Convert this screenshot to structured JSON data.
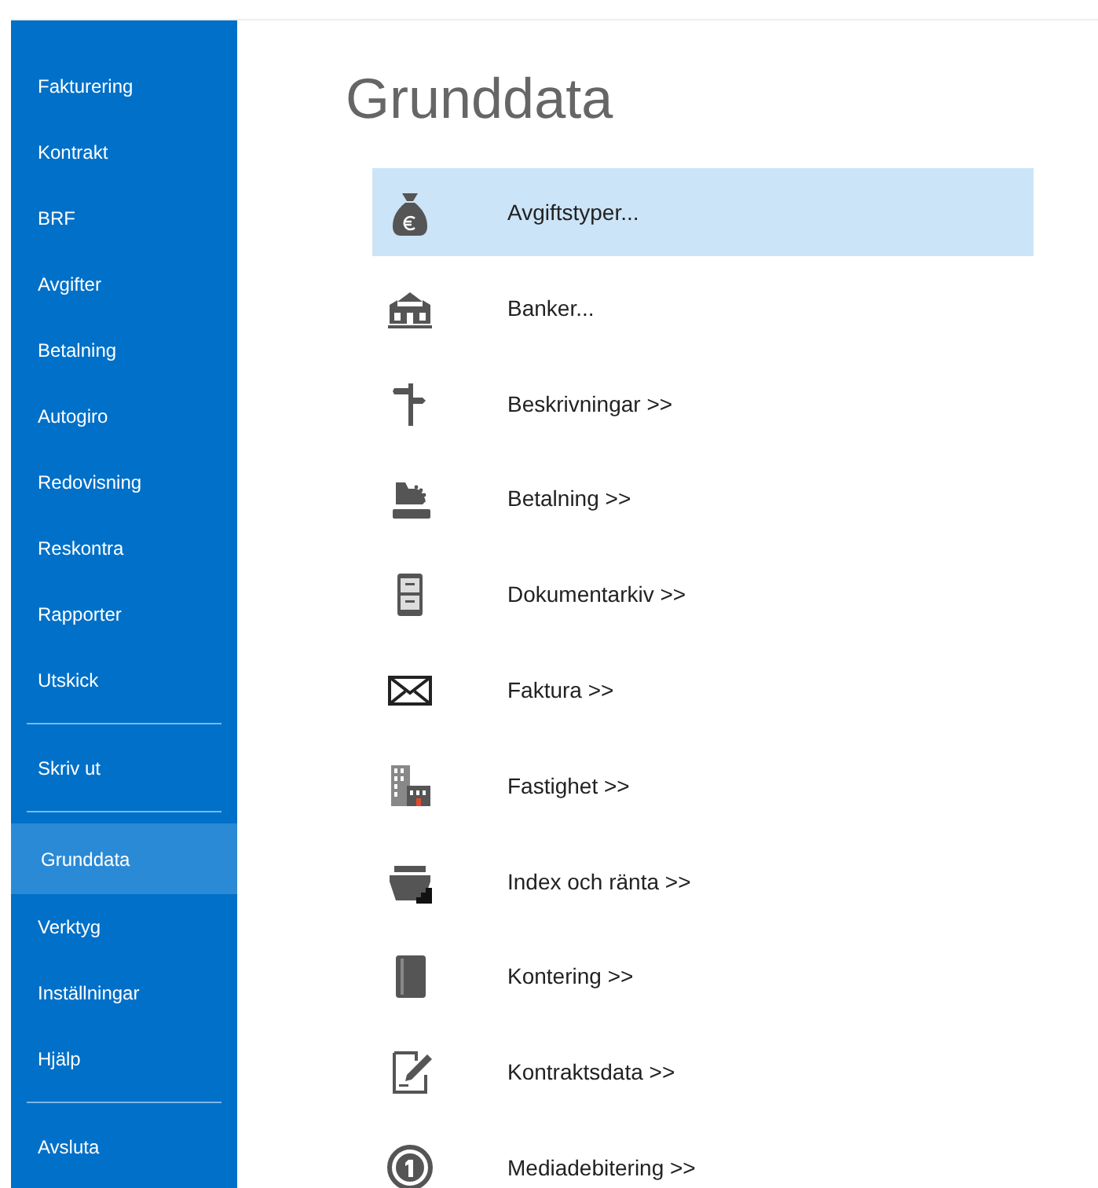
{
  "sidebar": {
    "items": [
      {
        "kind": "item",
        "label": "Fakturering",
        "selected": false
      },
      {
        "kind": "item",
        "label": "Kontrakt",
        "selected": false
      },
      {
        "kind": "item",
        "label": "BRF",
        "selected": false
      },
      {
        "kind": "item",
        "label": "Avgifter",
        "selected": false
      },
      {
        "kind": "item",
        "label": "Betalning",
        "selected": false
      },
      {
        "kind": "item",
        "label": "Autogiro",
        "selected": false
      },
      {
        "kind": "item",
        "label": "Redovisning",
        "selected": false
      },
      {
        "kind": "item",
        "label": "Reskontra",
        "selected": false
      },
      {
        "kind": "item",
        "label": "Rapporter",
        "selected": false
      },
      {
        "kind": "item",
        "label": "Utskick",
        "selected": false
      },
      {
        "kind": "divider"
      },
      {
        "kind": "item",
        "label": "Skriv ut",
        "selected": false
      },
      {
        "kind": "divider"
      },
      {
        "kind": "item",
        "label": "Grunddata",
        "selected": true
      },
      {
        "kind": "item",
        "label": "Verktyg",
        "selected": false
      },
      {
        "kind": "item",
        "label": "Inställningar",
        "selected": false
      },
      {
        "kind": "item",
        "label": "Hjälp",
        "selected": false
      },
      {
        "kind": "divider"
      },
      {
        "kind": "item",
        "label": "Avsluta",
        "selected": false
      }
    ]
  },
  "main": {
    "title": "Grunddata",
    "items": [
      {
        "label": "Avgiftstyper...",
        "selected": true
      },
      {
        "label": "Banker...",
        "selected": false
      },
      {
        "label": "Beskrivningar >>",
        "selected": false
      },
      {
        "label": "Betalning >>",
        "selected": false
      },
      {
        "label": "Dokumentarkiv >>",
        "selected": false
      },
      {
        "label": "Faktura >>",
        "selected": false
      },
      {
        "label": "Fastighet >>",
        "selected": false
      },
      {
        "label": "Index och ränta >>",
        "selected": false
      },
      {
        "label": "Kontering >>",
        "selected": false
      },
      {
        "label": "Kontraktsdata >>",
        "selected": false
      },
      {
        "label": "Mediadebitering >>",
        "selected": false
      }
    ]
  }
}
